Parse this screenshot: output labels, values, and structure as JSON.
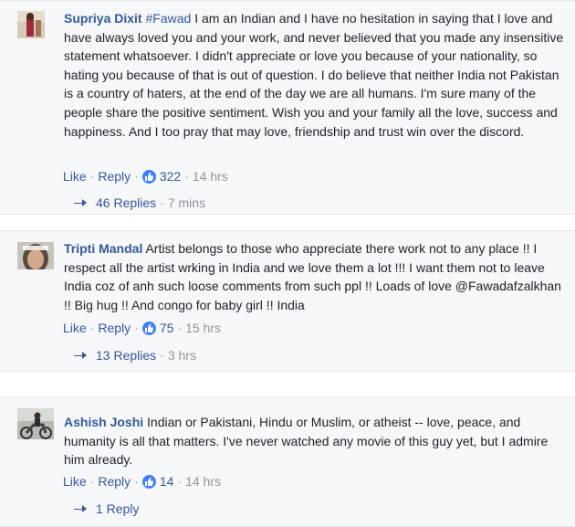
{
  "comments": [
    {
      "name": "Supriya Dixit",
      "tag": "#Fawad",
      "text": "I am an Indian and I have no hesitation in saying that I love and have always loved you and your work, and never believed that you made any insensitive statement whatsoever. I didn't appreciate or love you because of your nationality, so hating you because of that is out of question. I do believe that neither India not Pakistan is a country of haters, at the end of the day we are all humans. I'm sure many of the people share the positive sentiment. Wish you and your family all the love, success and happiness. And I too pray that may love, friendship and trust win over the discord.",
      "like_label": "Like",
      "reply_label": "Reply",
      "reaction_count": "322",
      "time": "14 hrs",
      "replies_label": "46 Replies",
      "replies_time": "7 mins"
    },
    {
      "name": "Tripti Mandal",
      "tag": "",
      "text": "Artist belongs to those who appreciate there work not to any place !! I respect all the artist wrking in India and we love them a lot !!! I want them not to leave India coz of anh such loose comments from such ppl !! Loads of love @Fawadafzalkhan !! Big hug !! And congo for baby girl !! India",
      "like_label": "Like",
      "reply_label": "Reply",
      "reaction_count": "75",
      "time": "15 hrs",
      "replies_label": "13 Replies",
      "replies_time": "3 hrs"
    },
    {
      "name": "Ashish Joshi",
      "tag": "",
      "text": "Indian or Pakistani, Hindu or Muslim, or atheist -- love, peace, and humanity is all that matters. I've never watched any movie of this guy yet, but I admire him already.",
      "like_label": "Like",
      "reply_label": "Reply",
      "reaction_count": "14",
      "time": "14 hrs",
      "replies_label": "1 Reply",
      "replies_time": ""
    }
  ],
  "colors": {
    "link": "#365899",
    "meta": "#90949c",
    "text": "#1d2129",
    "like_blue": "#4080ff",
    "card_bg": "#f6f7f9"
  }
}
